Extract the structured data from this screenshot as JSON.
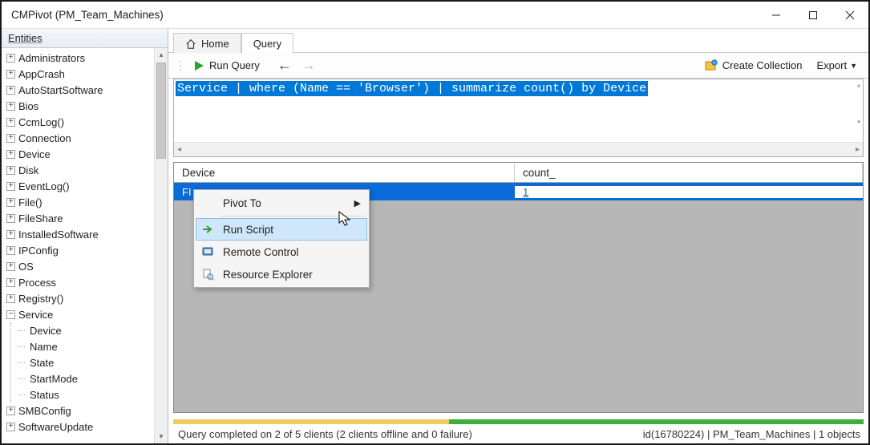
{
  "window": {
    "title": "CMPivot (PM_Team_Machines)"
  },
  "sidebar": {
    "header": "Entities",
    "items": [
      {
        "label": "Administrators",
        "expandable": true
      },
      {
        "label": "AppCrash",
        "expandable": true
      },
      {
        "label": "AutoStartSoftware",
        "expandable": true
      },
      {
        "label": "Bios",
        "expandable": true
      },
      {
        "label": "CcmLog()",
        "expandable": true
      },
      {
        "label": "Connection",
        "expandable": true
      },
      {
        "label": "Device",
        "expandable": true
      },
      {
        "label": "Disk",
        "expandable": true
      },
      {
        "label": "EventLog()",
        "expandable": true
      },
      {
        "label": "File()",
        "expandable": true
      },
      {
        "label": "FileShare",
        "expandable": true
      },
      {
        "label": "InstalledSoftware",
        "expandable": true
      },
      {
        "label": "IPConfig",
        "expandable": true
      },
      {
        "label": "OS",
        "expandable": true
      },
      {
        "label": "Process",
        "expandable": true
      },
      {
        "label": "Registry()",
        "expandable": true
      }
    ],
    "expanded": {
      "label": "Service",
      "children": [
        {
          "label": "Device"
        },
        {
          "label": "Name"
        },
        {
          "label": "State"
        },
        {
          "label": "StartMode"
        },
        {
          "label": "Status"
        }
      ]
    },
    "tail": [
      {
        "label": "SMBConfig",
        "expandable": true
      },
      {
        "label": "SoftwareUpdate",
        "expandable": true
      }
    ]
  },
  "tabs": {
    "home": "Home",
    "query": "Query"
  },
  "toolbar": {
    "run": "Run Query",
    "create_collection": "Create Collection",
    "export": "Export"
  },
  "query": {
    "text": "Service | where (Name == 'Browser') | summarize count() by Device"
  },
  "results": {
    "columns": {
      "device": "Device",
      "count": "count_"
    },
    "rows": [
      {
        "device": "FI",
        "count": "1"
      }
    ]
  },
  "context_menu": {
    "items": [
      {
        "label": "Pivot To",
        "submenu": true
      },
      {
        "label": "Run Script",
        "hover": true
      },
      {
        "label": "Remote Control"
      },
      {
        "label": "Resource Explorer"
      }
    ]
  },
  "status": {
    "left": "Query completed on 2 of 5 clients (2 clients offline and 0 failure)",
    "right": "id(16780224)  |  PM_Team_Machines  |  1 objects"
  }
}
